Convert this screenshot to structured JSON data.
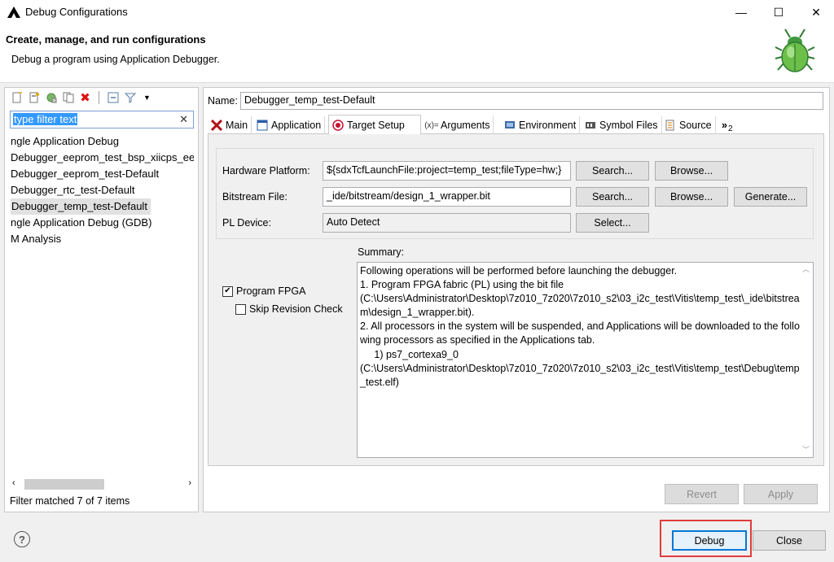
{
  "window": {
    "title": "Debug Configurations"
  },
  "header": {
    "title": "Create, manage, and run configurations",
    "subtitle": "Debug a program using Application Debugger."
  },
  "left": {
    "filter_value": "type filter text",
    "tree": [
      {
        "label": "ngle Application Debug",
        "selected": false
      },
      {
        "label": "Debugger_eeprom_test_bsp_xiicps_eep",
        "selected": false
      },
      {
        "label": "Debugger_eeprom_test-Default",
        "selected": false
      },
      {
        "label": "Debugger_rtc_test-Default",
        "selected": false
      },
      {
        "label": "Debugger_temp_test-Default",
        "selected": true
      },
      {
        "label": "ngle Application Debug (GDB)",
        "selected": false
      },
      {
        "label": "M Analysis",
        "selected": false
      }
    ],
    "status": "Filter matched 7 of 7 items"
  },
  "right": {
    "name_label": "Name:",
    "name_value": "Debugger_temp_test-Default",
    "tabs": [
      {
        "label": "Main",
        "icon": "xilinx-x-icon"
      },
      {
        "label": "Application",
        "icon": "window-icon"
      },
      {
        "label": "Target Setup",
        "icon": "target-icon",
        "active": true
      },
      {
        "label": "Arguments",
        "icon": "arguments-icon"
      },
      {
        "label": "Environment",
        "icon": "environment-icon"
      },
      {
        "label": "Symbol Files",
        "icon": "symbol-files-icon"
      },
      {
        "label": "Source",
        "icon": "source-icon"
      },
      {
        "label": "2",
        "icon": "overflow-chevron-icon"
      }
    ],
    "hardware_platform": {
      "label": "Hardware Platform:",
      "value": "${sdxTcfLaunchFile:project=temp_test;fileType=hw;}",
      "search": "Search...",
      "browse": "Browse..."
    },
    "bitstream": {
      "label": "Bitstream File:",
      "value": "_ide/bitstream/design_1_wrapper.bit",
      "search": "Search...",
      "browse": "Browse...",
      "generate": "Generate..."
    },
    "pl_device": {
      "label": "PL Device:",
      "value": "Auto Detect",
      "select": "Select..."
    },
    "program_fpga": {
      "label": "Program FPGA",
      "checked": true
    },
    "skip_revision": {
      "label": "Skip Revision Check",
      "checked": false
    },
    "summary_label": "Summary:",
    "summary_text": "Following operations will be performed before launching the debugger.\n1. Program FPGA fabric (PL) using the bit file\n(C:\\Users\\Administrator\\Desktop\\7z010_7z020\\7z010_s2\\03_i2c_test\\Vitis\\temp_test\\_ide\\bitstream\\design_1_wrapper.bit).\n2. All processors in the system will be suspended, and Applications will be downloaded to the following processors as specified in the Applications tab.\n     1) ps7_cortexa9_0\n(C:\\Users\\Administrator\\Desktop\\7z010_7z020\\7z010_s2\\03_i2c_test\\Vitis\\temp_test\\Debug\\temp_test.elf)",
    "revert": "Revert",
    "apply": "Apply"
  },
  "footer": {
    "debug": "Debug",
    "close": "Close"
  },
  "colors": {
    "highlight_box": "#e03c3c",
    "selection": "#3399ff",
    "default_button": "#0078d7"
  }
}
